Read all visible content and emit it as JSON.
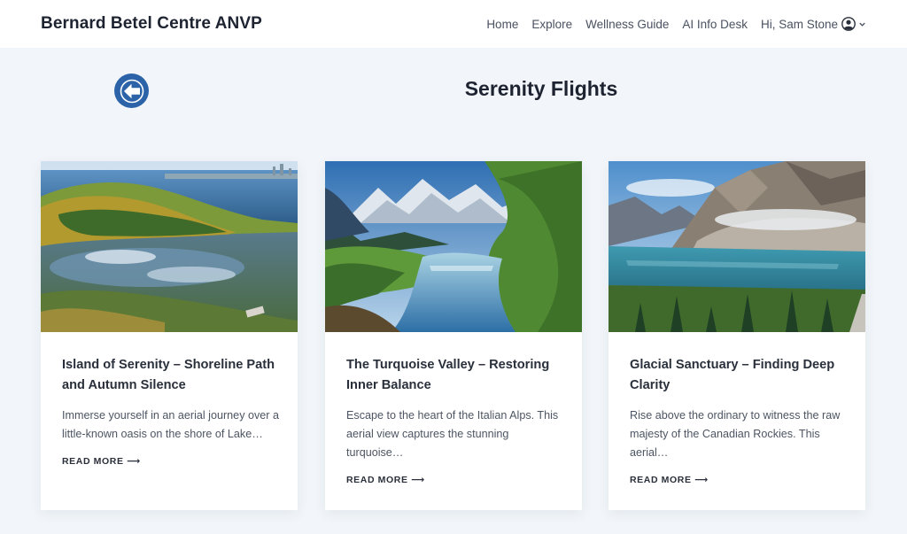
{
  "header": {
    "site_title": "Bernard Betel Centre ANVP",
    "nav": [
      "Home",
      "Explore",
      "Wellness Guide",
      "AI Info Desk"
    ],
    "user_label": "Hi, Sam Stone"
  },
  "page": {
    "title": "Serenity Flights"
  },
  "cards": [
    {
      "title": "Island of Serenity – Shoreline Path and Autumn Silence",
      "excerpt": "Immerse yourself in an aerial journey over a little-known oasis on the shore of Lake…",
      "read_more": "READ MORE ⟶",
      "image": "aerial-island-autumn-lake"
    },
    {
      "title": "The Turquoise Valley – Restoring Inner Balance",
      "excerpt": "Escape to the heart of the Italian Alps. This aerial view captures the stunning turquoise…",
      "read_more": "READ MORE ⟶",
      "image": "alpine-turquoise-river-valley"
    },
    {
      "title": "Glacial Sanctuary – Finding Deep Clarity",
      "excerpt": "Rise above the ordinary to witness the raw majesty of the Canadian Rockies. This aerial…",
      "read_more": "READ MORE ⟶",
      "image": "rocky-mountain-glacial-lake"
    }
  ],
  "colors": {
    "accent": "#2c63a8",
    "background": "#f2f6fa",
    "header_bg": "#ffffff",
    "text_dark": "#1d2330"
  }
}
